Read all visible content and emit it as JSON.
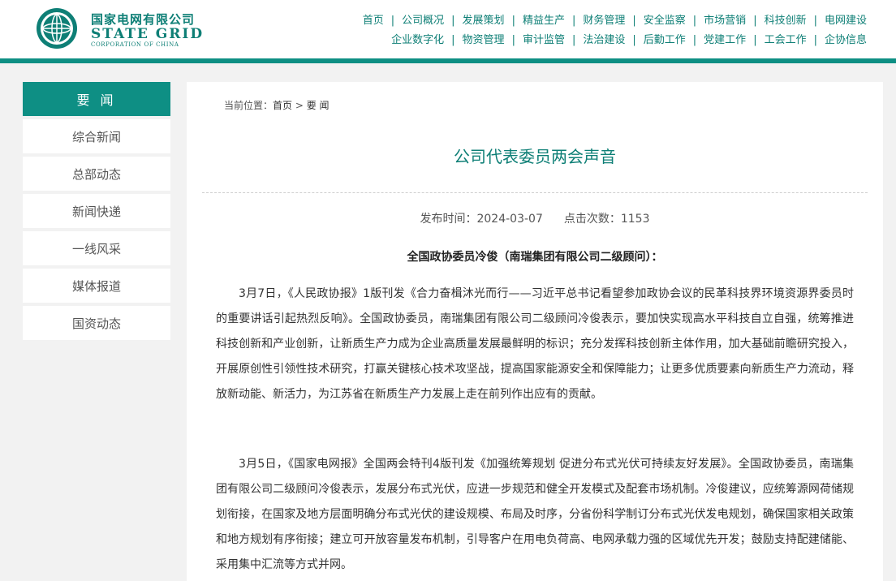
{
  "brand": {
    "name_cn": "国家电网有限公司",
    "name_en": "STATE GRID",
    "name_en_sub": "CORPORATION OF CHINA"
  },
  "nav": {
    "row1": [
      "首页",
      "公司概况",
      "发展策划",
      "精益生产",
      "财务管理",
      "安全监察",
      "市场营销",
      "科技创新",
      "电网建设"
    ],
    "row2": [
      "企业数字化",
      "物资管理",
      "审计监管",
      "法治建设",
      "后勤工作",
      "党建工作",
      "工会工作",
      "企协信息"
    ]
  },
  "sidebar": {
    "heading": "要 闻",
    "items": [
      "综合新闻",
      "总部动态",
      "新闻快递",
      "一线风采",
      "媒体报道",
      "国资动态"
    ]
  },
  "breadcrumb": {
    "prefix": "当前位置：",
    "home": "首页",
    "sep": " > ",
    "current": "要 闻"
  },
  "article": {
    "title": "公司代表委员两会声音",
    "publish_label": "发布时间：2024-03-07",
    "views_label": "点击次数：1153",
    "subhead": "全国政协委员冷俊（南瑞集团有限公司二级顾问）：",
    "paragraphs": [
      "3月7日，《人民政协报》1版刊发《合力奋楫沐光而行——习近平总书记看望参加政协会议的民革科技界环境资源界委员时的重要讲话引起热烈反响》。全国政协委员，南瑞集团有限公司二级顾问冷俊表示，要加快实现高水平科技自立自强，统筹推进科技创新和产业创新，让新质生产力成为企业高质量发展最鲜明的标识；充分发挥科技创新主体作用，加大基础前瞻研究投入，开展原创性引领性技术研究，打赢关键核心技术攻坚战，提高国家能源安全和保障能力；让更多优质要素向新质生产力流动，释放新动能、新活力，为江苏省在新质生产力发展上走在前列作出应有的贡献。",
      "3月5日，《国家电网报》全国两会特刊4版刊发《加强统筹规划 促进分布式光伏可持续友好发展》。全国政协委员，南瑞集团有限公司二级顾问冷俊表示，发展分布式光伏，应进一步规范和健全开发模式及配套市场机制。冷俊建议，应统筹源网荷储规划衔接，在国家及地方层面明确分布式光伏的建设规模、布局及时序，分省份科学制订分布式光伏发电规划，确保国家相关政策和地方规划有序衔接；建立可开放容量发布机制，引导客户在用电负荷高、电网承载力强的区域优先开发；鼓励支持配建储能、采用集中汇流等方式并网。"
    ]
  },
  "colors": {
    "brand_teal": "#0e7f76",
    "bar_teal": "#0e8f84",
    "page_bg": "#f2f2f2"
  }
}
